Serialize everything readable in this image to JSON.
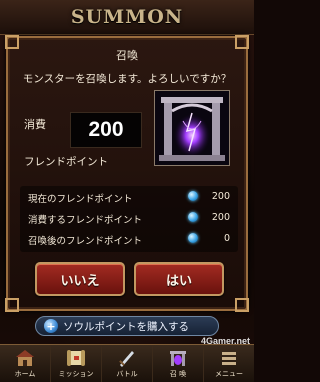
{
  "header": {
    "title": "SUMMON"
  },
  "dialog": {
    "title": "召喚",
    "message": "モンスターを召喚します。よろしいですか？",
    "cost_label": "消費",
    "cost_value": "200",
    "friend_label": "フレンドポイント",
    "stats": [
      {
        "label": "現在のフレンドポイント",
        "value": "200"
      },
      {
        "label": "消費するフレンドポイント",
        "value": "200"
      },
      {
        "label": "召喚後のフレンドポイント",
        "value": "0"
      }
    ],
    "no_label": "いいえ",
    "yes_label": "はい"
  },
  "soul_button": {
    "icon": "plus-icon",
    "label": "ソウルポイントを購入する",
    "icon_glyph": "+"
  },
  "nav": [
    {
      "label": "ホーム",
      "icon": "home-icon"
    },
    {
      "label": "ミッション",
      "icon": "scroll-icon"
    },
    {
      "label": "バトル",
      "icon": "sword-icon"
    },
    {
      "label": "召 喚",
      "icon": "summon-icon"
    },
    {
      "label": "メニュー",
      "icon": "menu-icon"
    }
  ],
  "watermark": "4Gamer.net",
  "colors": {
    "accent": "#9a6d3e",
    "button": "#a32b22",
    "dot": "#3aa3e6"
  }
}
